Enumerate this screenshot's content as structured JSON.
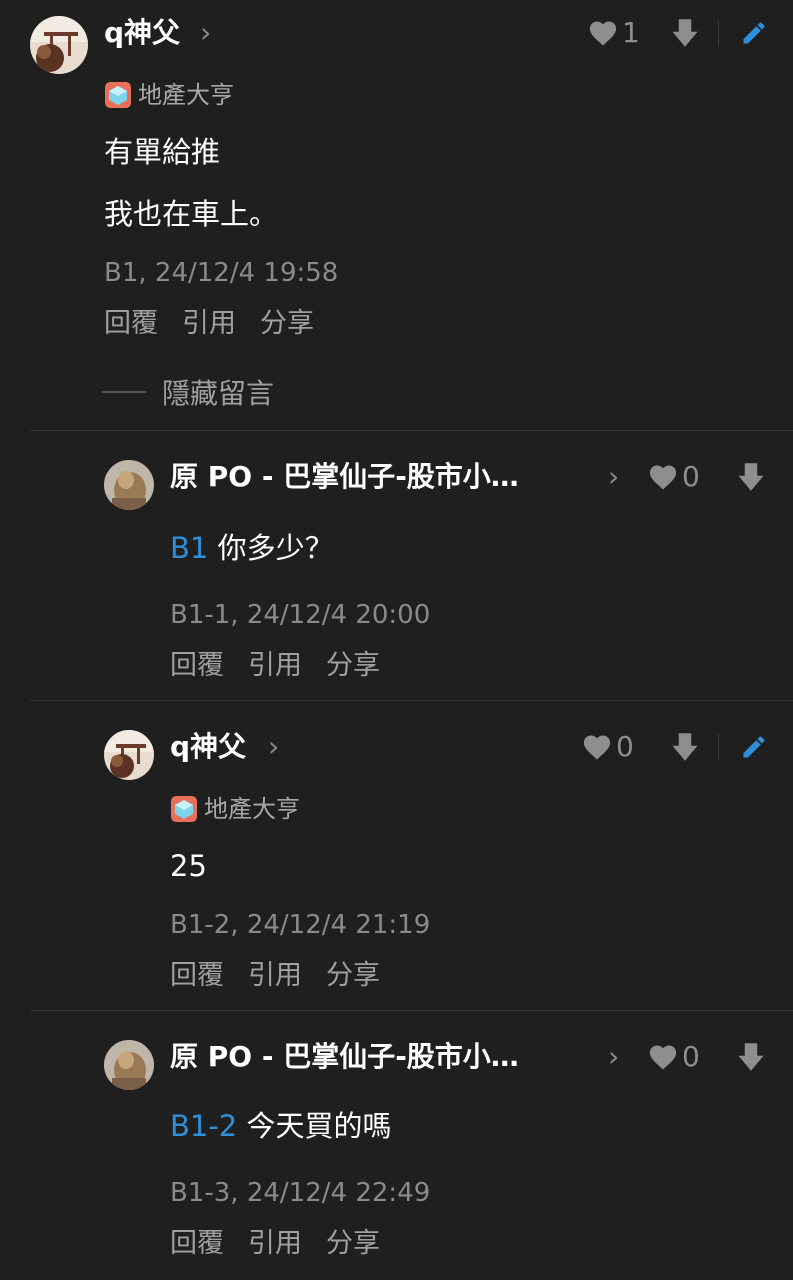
{
  "comments": [
    {
      "username": "q神父",
      "badge": "地產大亨",
      "like_count": "1",
      "lines": [
        "有單給推",
        "我也在車上。"
      ],
      "meta": "B1, 24/12/4 19:58",
      "actions": [
        "回覆",
        "引用",
        "分享"
      ],
      "hide_label": "隱藏留言"
    },
    {
      "username": "原 PO - 巴掌仙子-股市小…",
      "like_count": "0",
      "ref": "B1",
      "text": "你多少？",
      "meta": "B1-1, 24/12/4 20:00",
      "actions": [
        "回覆",
        "引用",
        "分享"
      ]
    },
    {
      "username": "q神父",
      "badge": "地產大亨",
      "like_count": "0",
      "text": "25",
      "meta": "B1-2, 24/12/4 21:19",
      "actions": [
        "回覆",
        "引用",
        "分享"
      ]
    },
    {
      "username": "原 PO - 巴掌仙子-股市小…",
      "like_count": "0",
      "ref": "B1-2",
      "text": "今天買的嗎",
      "meta": "B1-3, 24/12/4 22:49",
      "actions": [
        "回覆",
        "引用",
        "分享"
      ]
    }
  ],
  "icons": {
    "heart": "heart-icon",
    "downvote": "downvote-icon",
    "edit": "edit-pencil-icon",
    "chevron": "chevron-right-icon",
    "badge": "cube-badge-icon"
  },
  "colors": {
    "background": "#1f1f1f",
    "accent": "#2f8fd8",
    "muted": "#8a8a8a"
  }
}
